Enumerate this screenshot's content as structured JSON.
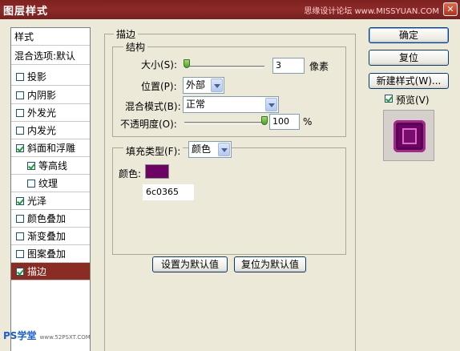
{
  "window": {
    "title": "图层样式",
    "watermark": "思缘设计论坛 www.MISSYUAN.COM",
    "close_symbol": "✕"
  },
  "sidebar": {
    "header": "样式",
    "blend_options": "混合选项:默认",
    "items": [
      {
        "label": "投影",
        "checked": false
      },
      {
        "label": "内阴影",
        "checked": false
      },
      {
        "label": "外发光",
        "checked": false
      },
      {
        "label": "内发光",
        "checked": false
      },
      {
        "label": "斜面和浮雕",
        "checked": true
      },
      {
        "label": "等高线",
        "checked": true
      },
      {
        "label": "纹理",
        "checked": false
      },
      {
        "label": "光泽",
        "checked": true
      },
      {
        "label": "颜色叠加",
        "checked": false
      },
      {
        "label": "渐变叠加",
        "checked": false
      },
      {
        "label": "图案叠加",
        "checked": false
      },
      {
        "label": "描边",
        "checked": true
      }
    ]
  },
  "stroke": {
    "section_title": "描边",
    "structure_title": "结构",
    "size_label": "大小(S):",
    "size_value": "3",
    "size_unit": "像素",
    "position_label": "位置(P):",
    "position_value": "外部",
    "blend_mode_label": "混合模式(B):",
    "blend_mode_value": "正常",
    "opacity_label": "不透明度(O):",
    "opacity_value": "100",
    "opacity_unit": "%",
    "fill_type_label": "填充类型(F):",
    "fill_type_value": "颜色",
    "color_label": "颜色:",
    "color_hex": "6c0365",
    "color_swatch": "#6c0365",
    "set_default_button": "设置为默认值",
    "reset_default_button": "复位为默认值"
  },
  "actions": {
    "ok": "确定",
    "reset": "复位",
    "new_style": "新建样式(W)...",
    "preview_label": "预览(V)",
    "preview_checked": true
  },
  "corner_watermark": "PS学堂",
  "corner_watermark_small": "www.52PSXT.COM",
  "colors": {
    "title_bar": "#7d2120",
    "selected_row": "#8b2c24",
    "stroke_color": "#6c0365"
  }
}
